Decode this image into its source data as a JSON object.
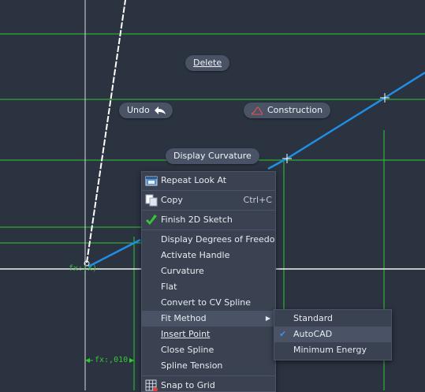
{
  "canvas": {
    "colors": {
      "background": "#2b3240",
      "grid_green": "#2ecc2e",
      "spline_blue": "#1f8fe6",
      "axis_white": "#f2f2f2"
    },
    "dimensions": {
      "fx_label": "fx:,010",
      "point_label": "fx:(x)"
    }
  },
  "marking_menu": {
    "delete": "Delete",
    "undo": "Undo",
    "construction": "Construction",
    "display_curvature": "Display Curvature",
    "icons": {
      "undo": "undo-arrow-icon",
      "construction": "construction-line-icon"
    }
  },
  "context_menu": {
    "items": [
      {
        "label": "Repeat Look At",
        "icon": "look-at-icon"
      },
      {
        "label": "Copy",
        "shortcut": "Ctrl+C",
        "icon": "copy-icon"
      },
      {
        "label": "Finish 2D Sketch",
        "icon": "green-check-icon"
      },
      {
        "label": "Display Degrees of Freedom"
      },
      {
        "label": "Activate Handle"
      },
      {
        "label": "Curvature"
      },
      {
        "label": "Flat"
      },
      {
        "label": "Convert to CV Spline"
      },
      {
        "label": "Fit Method"
      },
      {
        "label": "Insert Point"
      },
      {
        "label": "Close Spline"
      },
      {
        "label": "Spline Tension"
      },
      {
        "label": "Snap to Grid",
        "icon": "grid-snap-icon"
      }
    ]
  },
  "fit_method_submenu": {
    "items": [
      {
        "label": "Standard",
        "checked": false
      },
      {
        "label": "AutoCAD",
        "checked": true
      },
      {
        "label": "Minimum Energy",
        "checked": false
      }
    ]
  }
}
